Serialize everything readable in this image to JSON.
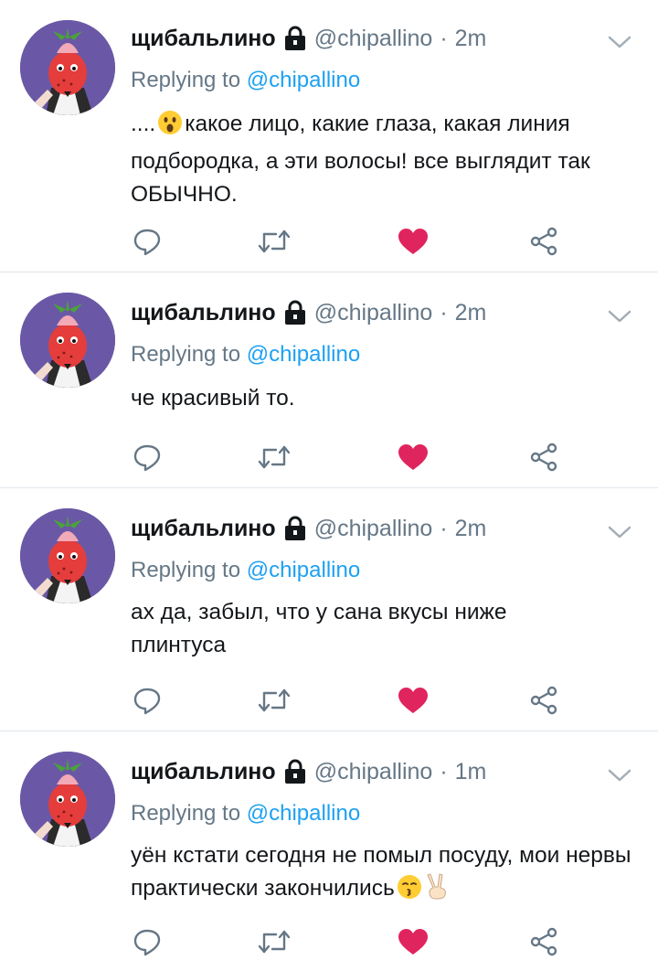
{
  "colors": {
    "name": "#14171a",
    "meta": "#657786",
    "link": "#1da1f2",
    "like": "#e0245e",
    "divider": "#e1e8ed",
    "avatar_bg": "#6a58a6"
  },
  "icons": {
    "protected": "lock-icon",
    "menu": "chevron-down-icon",
    "reply": "reply-icon",
    "retweet": "retweet-icon",
    "like": "heart-icon",
    "share": "share-icon"
  },
  "tweets": [
    {
      "author_name": "щибальлино",
      "handle": "@chipallino",
      "separator": "·",
      "time": "2m",
      "replying_label": "Replying to",
      "replying_to": "@chipallino",
      "text_before_emoji": "....",
      "text": "какое лицо, какие глаза, какая линия подбородка, а эти волосы! все выглядит так ОБЫЧНО.",
      "liked": true
    },
    {
      "author_name": "щибальлино",
      "handle": "@chipallino",
      "separator": "·",
      "time": "2m",
      "replying_label": "Replying to",
      "replying_to": "@chipallino",
      "text": "че красивый то.",
      "liked": true
    },
    {
      "author_name": "щибальлино",
      "handle": "@chipallino",
      "separator": "·",
      "time": "2m",
      "replying_label": "Replying to",
      "replying_to": "@chipallino",
      "text": "ах да, забыл, что у сана вкусы ниже плинтуса",
      "liked": true
    },
    {
      "author_name": "щибальлино",
      "handle": "@chipallino",
      "separator": "·",
      "time": "1m",
      "replying_label": "Replying to",
      "replying_to": "@chipallino",
      "text": "уён кстати сегодня не помыл посуду, мои нервы практически закончились",
      "liked": true
    }
  ]
}
